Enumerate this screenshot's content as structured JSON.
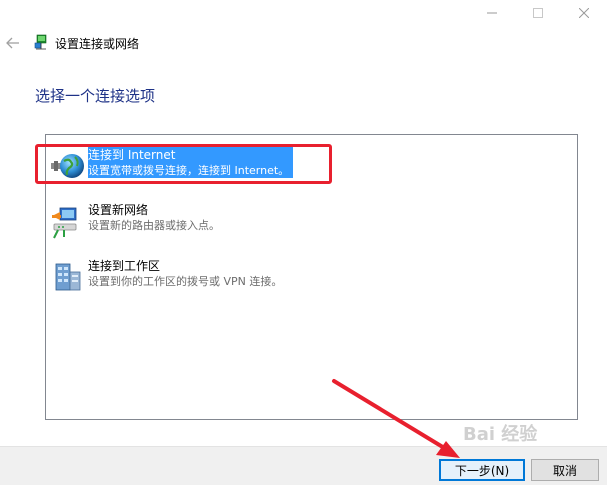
{
  "window": {
    "title": "设置连接或网络"
  },
  "heading": "选择一个连接选项",
  "options": [
    {
      "title": "连接到 Internet",
      "desc": "设置宽带或拨号连接，连接到 Internet。",
      "selected": true
    },
    {
      "title": "设置新网络",
      "desc": "设置新的路由器或接入点。",
      "selected": false
    },
    {
      "title": "连接到工作区",
      "desc": "设置到你的工作区的拨号或 VPN 连接。",
      "selected": false
    }
  ],
  "buttons": {
    "next_label": "下一步(N)",
    "cancel_label": "取消"
  },
  "colors": {
    "heading": "#1e3287",
    "selection": "#3399ff",
    "annotation_red": "#e8202e",
    "primary_border": "#0078d7"
  },
  "watermark": "Bai 经验"
}
